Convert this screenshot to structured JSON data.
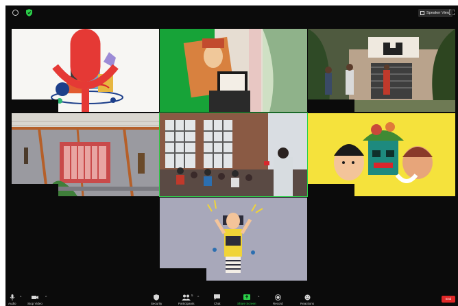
{
  "window": {
    "speaker_view_label": "Speaker View"
  },
  "toolbar": {
    "audio_label": "Audio",
    "video_label": "Stop Video",
    "security_label": "Security",
    "participants_label": "Participants",
    "participants_count": "5",
    "chat_label": "Chat",
    "share_label": "Share Screen",
    "record_label": "Record",
    "reactions_label": "Reactions",
    "end_label": "End"
  },
  "colors": {
    "app_background": "#0b0b0b",
    "active_speaker_border": "#2bd14a",
    "share_screen_green": "#2bd14a",
    "end_button_red": "#e02828",
    "muted_mic_red": "#e53935",
    "security_shield_green": "#2bd14a"
  },
  "icons": {
    "top_left": [
      "info-icon",
      "shield-icon"
    ],
    "top_right": [
      "speaker-view-grid-icon",
      "fullscreen-icon"
    ],
    "toolbar": [
      "microphone-icon",
      "video-camera-icon",
      "shield-icon",
      "participants-icon",
      "chat-bubble-icon",
      "share-screen-icon",
      "record-icon",
      "reactions-icon"
    ]
  }
}
